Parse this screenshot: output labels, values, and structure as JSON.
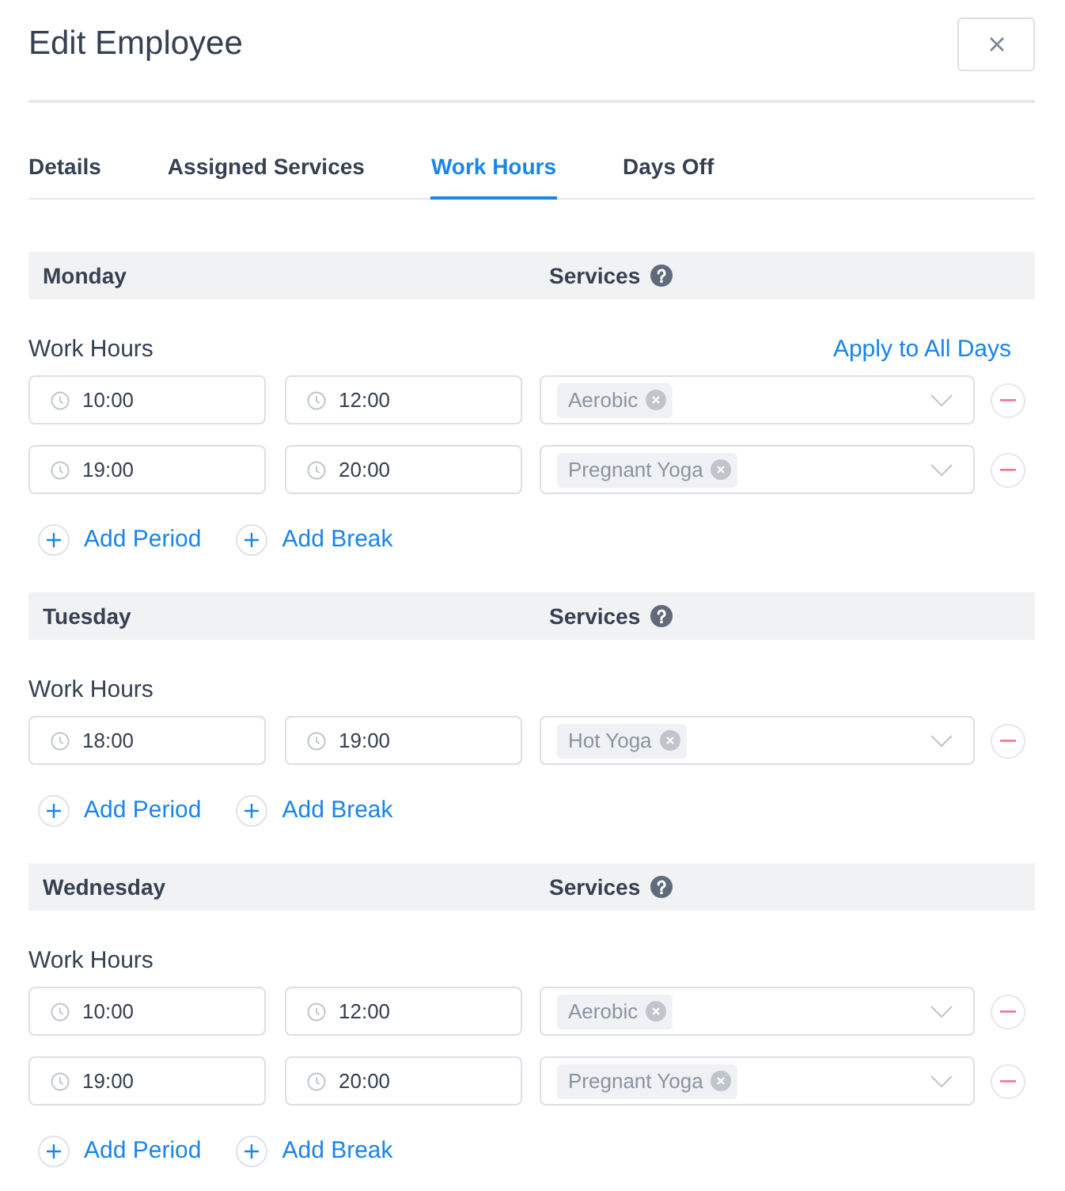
{
  "dialog": {
    "title": "Edit Employee"
  },
  "tabs": [
    {
      "label": "Details",
      "selected": false
    },
    {
      "label": "Assigned Services",
      "selected": false
    },
    {
      "label": "Work Hours",
      "selected": true
    },
    {
      "label": "Days Off",
      "selected": false
    }
  ],
  "days": [
    {
      "name": "Monday",
      "services_label": "Services",
      "work_hours_label": "Work Hours",
      "apply_link": "Apply to All Days",
      "periods": [
        {
          "start": "10:00",
          "end": "12:00",
          "services": [
            "Aerobic"
          ]
        },
        {
          "start": "19:00",
          "end": "20:00",
          "services": [
            "Pregnant Yoga"
          ]
        }
      ],
      "add_period": "Add Period",
      "add_break": "Add Break"
    },
    {
      "name": "Tuesday",
      "services_label": "Services",
      "work_hours_label": "Work Hours",
      "periods": [
        {
          "start": "18:00",
          "end": "19:00",
          "services": [
            "Hot Yoga"
          ]
        }
      ],
      "add_period": "Add Period",
      "add_break": "Add Break"
    },
    {
      "name": "Wednesday",
      "services_label": "Services",
      "work_hours_label": "Work Hours",
      "periods": [
        {
          "start": "10:00",
          "end": "12:00",
          "services": [
            "Aerobic"
          ]
        },
        {
          "start": "19:00",
          "end": "20:00",
          "services": [
            "Pregnant Yoga"
          ]
        }
      ],
      "add_period": "Add Period",
      "add_break": "Add Break"
    }
  ]
}
